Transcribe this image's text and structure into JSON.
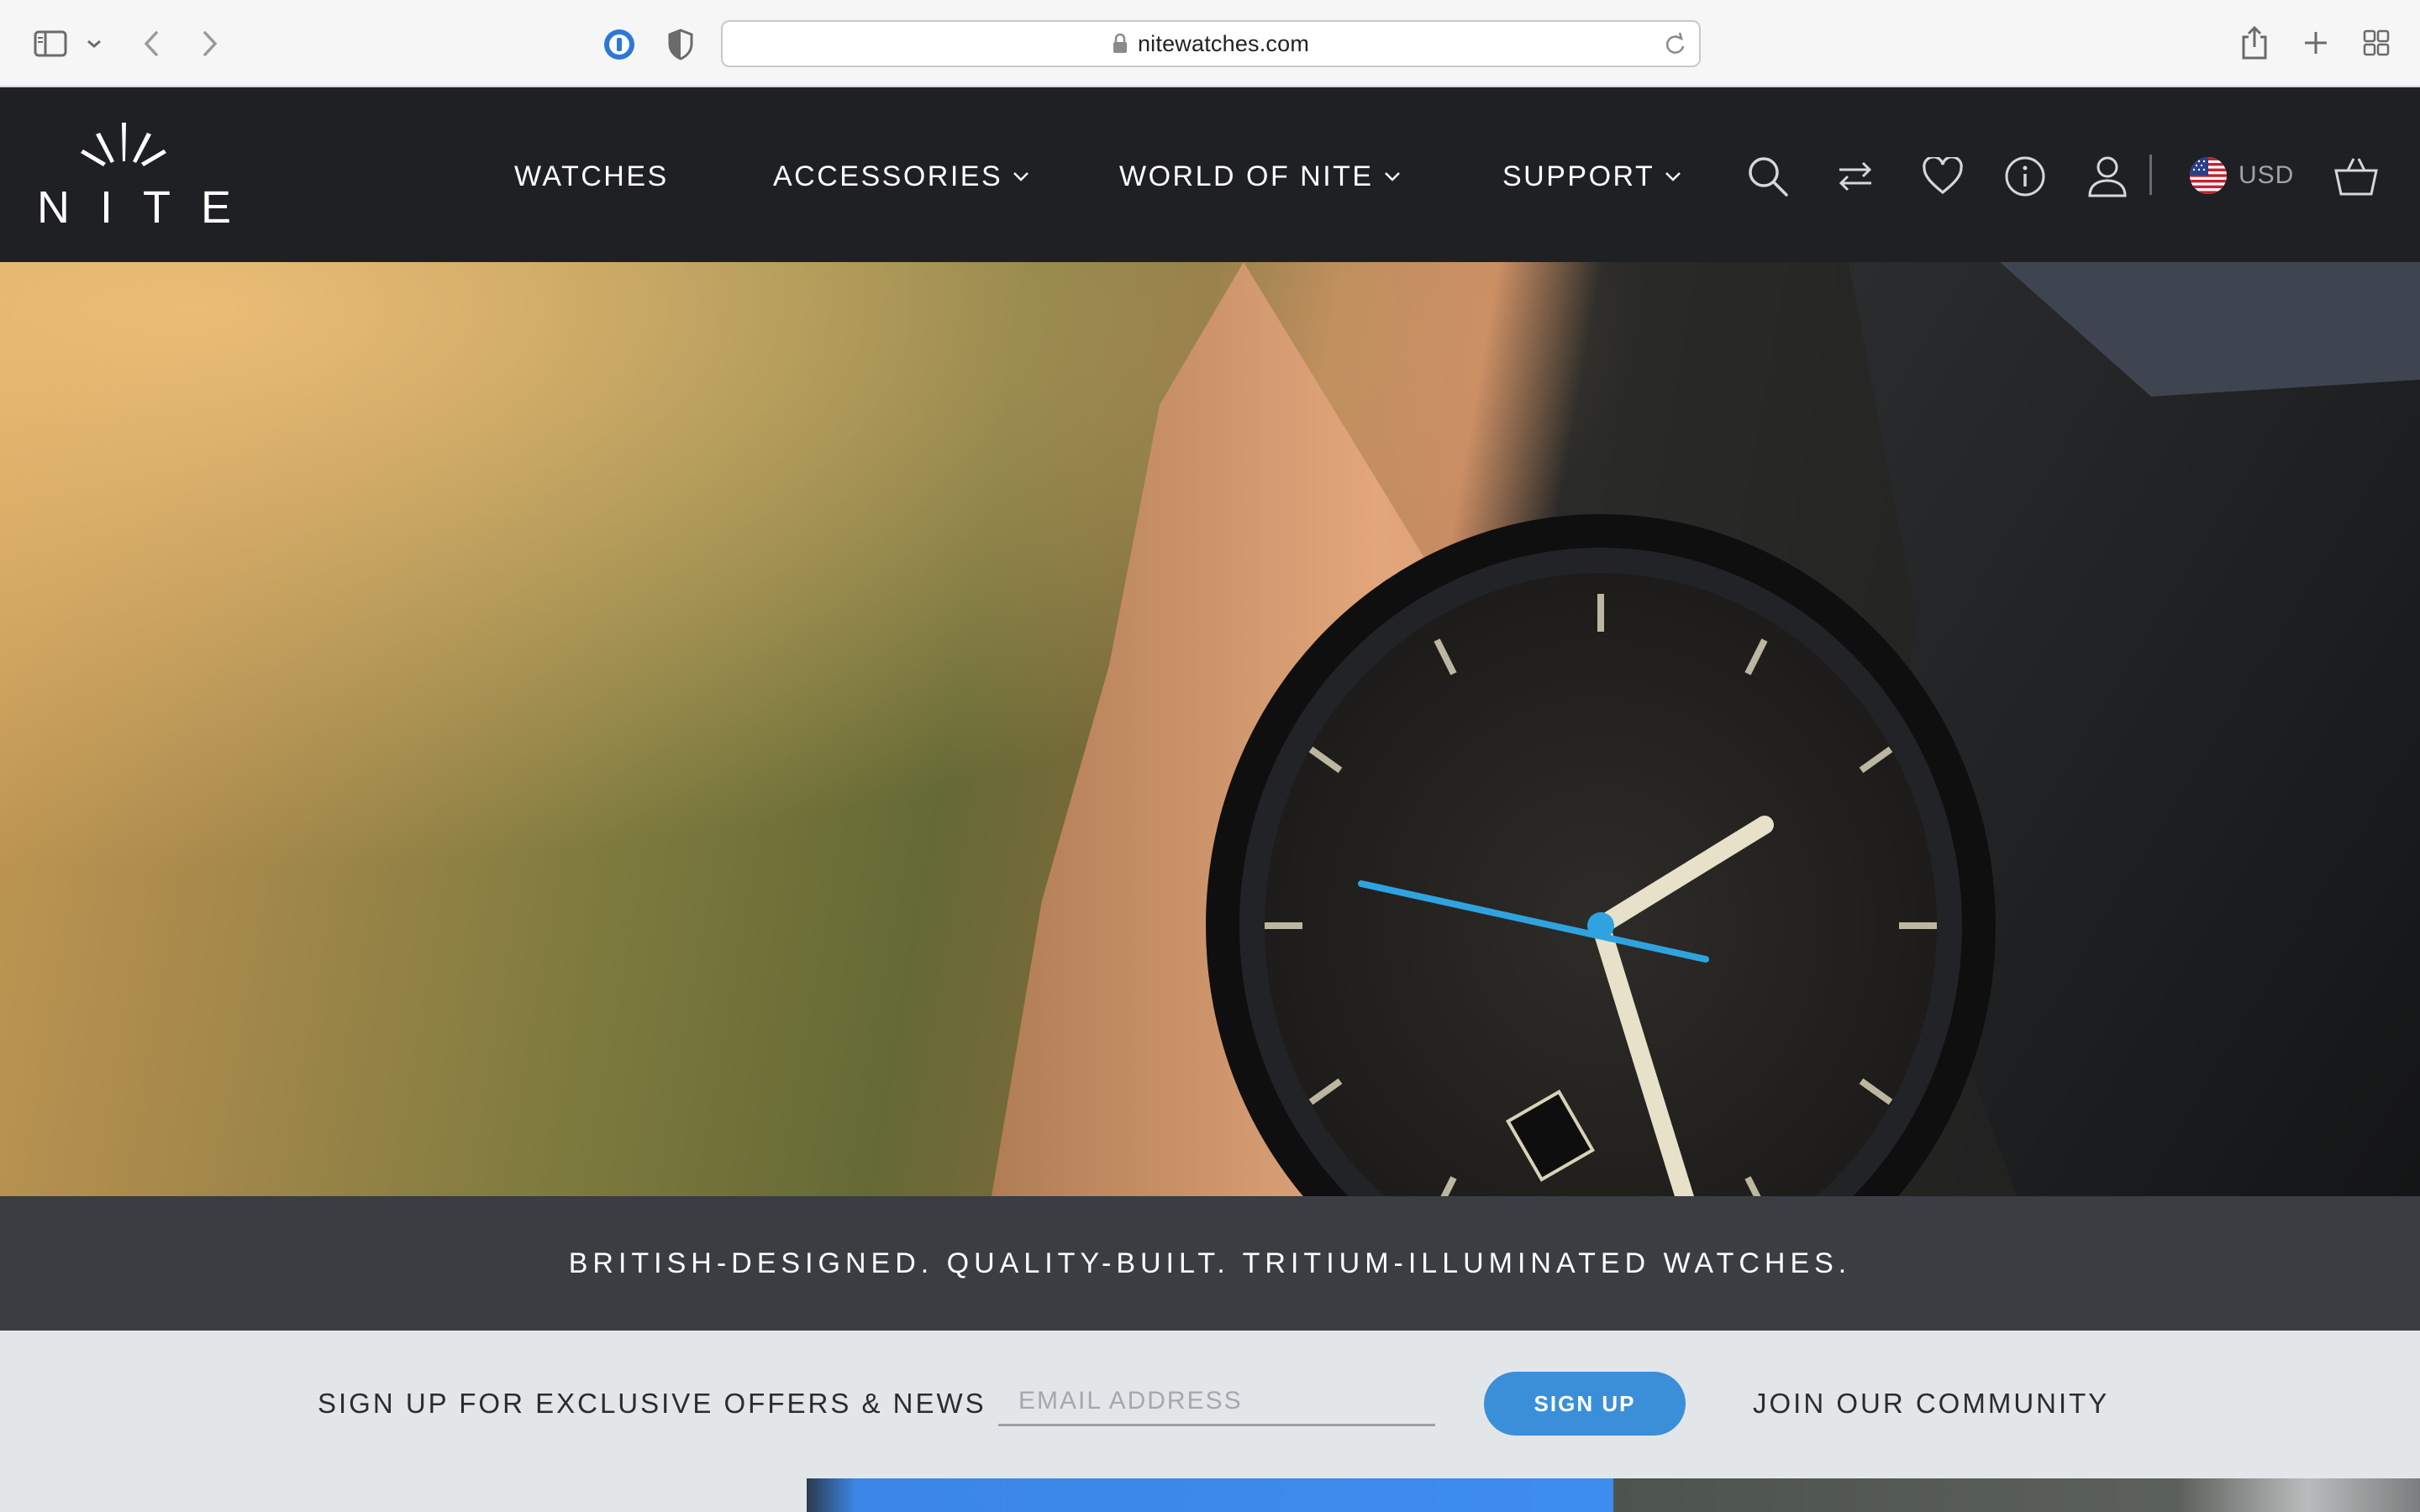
{
  "browser": {
    "url": "nitewatches.com",
    "icons": [
      "sidebar-icon",
      "chevron-down-icon",
      "back-icon",
      "forward-icon",
      "password-manager-icon",
      "privacy-shield-icon",
      "lock-icon",
      "reload-icon",
      "share-icon",
      "new-tab-icon",
      "tab-overview-icon"
    ]
  },
  "header": {
    "logo_text": "NITE",
    "nav": [
      {
        "label": "WATCHES",
        "has_dropdown": false
      },
      {
        "label": "ACCESSORIES",
        "has_dropdown": true
      },
      {
        "label": "WORLD OF NITE",
        "has_dropdown": true
      },
      {
        "label": "SUPPORT",
        "has_dropdown": true
      }
    ],
    "icons": [
      "search-icon",
      "compare-icon",
      "wishlist-heart-icon",
      "info-icon",
      "account-icon",
      "basket-icon"
    ],
    "currency": "USD",
    "currency_flag": "us-flag-icon"
  },
  "hero": {
    "image": "close-up of black NITE MX10 watch with blue seconds hand on wrist"
  },
  "tagline": "BRITISH-DESIGNED. QUALITY-BUILT. TRITIUM-ILLUMINATED WATCHES.",
  "signup": {
    "prompt": "SIGN UP FOR EXCLUSIVE OFFERS & NEWS",
    "email_placeholder": "EMAIL ADDRESS",
    "email_value": "",
    "button_label": "SIGN UP",
    "community_link": "JOIN OUR COMMUNITY"
  },
  "colors": {
    "header_bg": "#1f2024",
    "tagline_bg": "#3a3d42",
    "signup_bg": "#e3e6e9",
    "accent": "#3b8fd9"
  }
}
